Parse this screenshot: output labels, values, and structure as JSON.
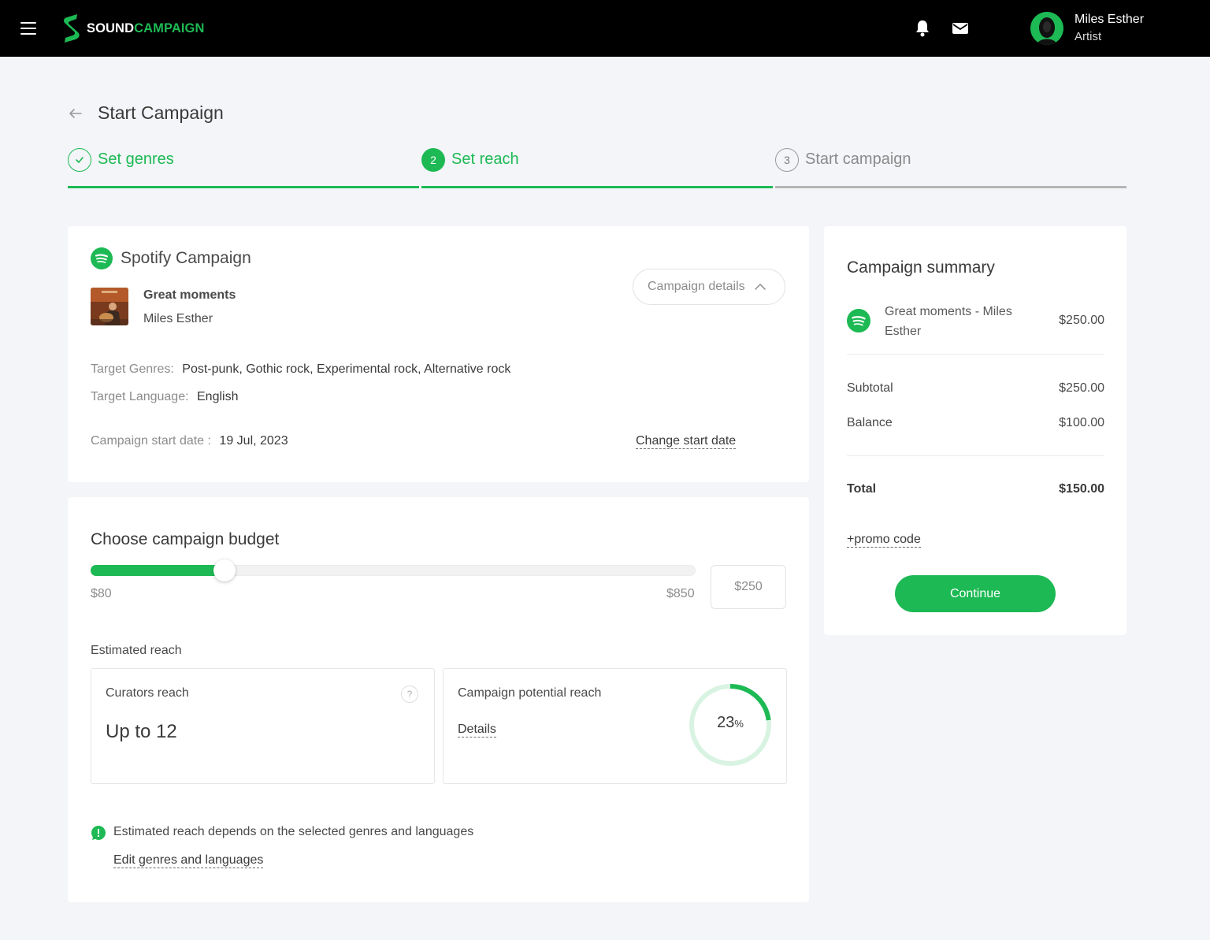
{
  "app": {
    "brand_part1": "SOUND",
    "brand_part2": "CAMPAIGN",
    "accent_color": "#1db954"
  },
  "user": {
    "name": "Miles Esther",
    "role": "Artist"
  },
  "header": {
    "title": "Start Campaign"
  },
  "steps": [
    {
      "number": "1",
      "label": "Set genres",
      "state": "done"
    },
    {
      "number": "2",
      "label": "Set reach",
      "state": "active"
    },
    {
      "number": "3",
      "label": "Start campaign",
      "state": "pending"
    }
  ],
  "campaign": {
    "title": "Spotify Campaign",
    "track_name": "Great moments",
    "artist": "Miles Esther",
    "details_button": "Campaign details",
    "genres_label": "Target Genres:",
    "genres_value": "Post-punk, Gothic rock, Experimental rock, Alternative rock",
    "language_label": "Target Language:",
    "language_value": "English",
    "start_label": "Campaign start date :",
    "start_value": "19 Jul, 2023",
    "change_start_link": "Change start date"
  },
  "budget": {
    "title": "Choose campaign budget",
    "min_label": "$80",
    "max_label": "$850",
    "min": 80,
    "max": 850,
    "value": 250,
    "input_value": "$250",
    "estimated_reach_label": "Estimated reach",
    "curators_reach_label": "Curators reach",
    "curators_reach_value": "Up to 12",
    "help_symbol": "?",
    "potential_reach_label": "Campaign potential reach",
    "details_link": "Details",
    "potential_percent": 23,
    "potential_percent_text": "23",
    "percent_sign": "%",
    "info_text": "Estimated reach depends on the selected genres and languages",
    "edit_link": "Edit genres and languages"
  },
  "summary": {
    "title": "Campaign summary",
    "item_name": "Great moments - Miles Esther",
    "item_price": "$250.00",
    "subtotal_label": "Subtotal",
    "subtotal_value": "$250.00",
    "balance_label": "Balance",
    "balance_value": "$100.00",
    "total_label": "Total",
    "total_value": "$150.00",
    "promo_link": "+promo code",
    "continue_button": "Continue"
  },
  "icons": {
    "menu": "hamburger-icon",
    "notifications": "bell-icon",
    "messages": "mail-icon",
    "back": "arrow-left-icon",
    "step_done": "check-icon",
    "spotify": "spotify-icon",
    "chevron": "chevron-up-icon",
    "info": "info-icon"
  }
}
